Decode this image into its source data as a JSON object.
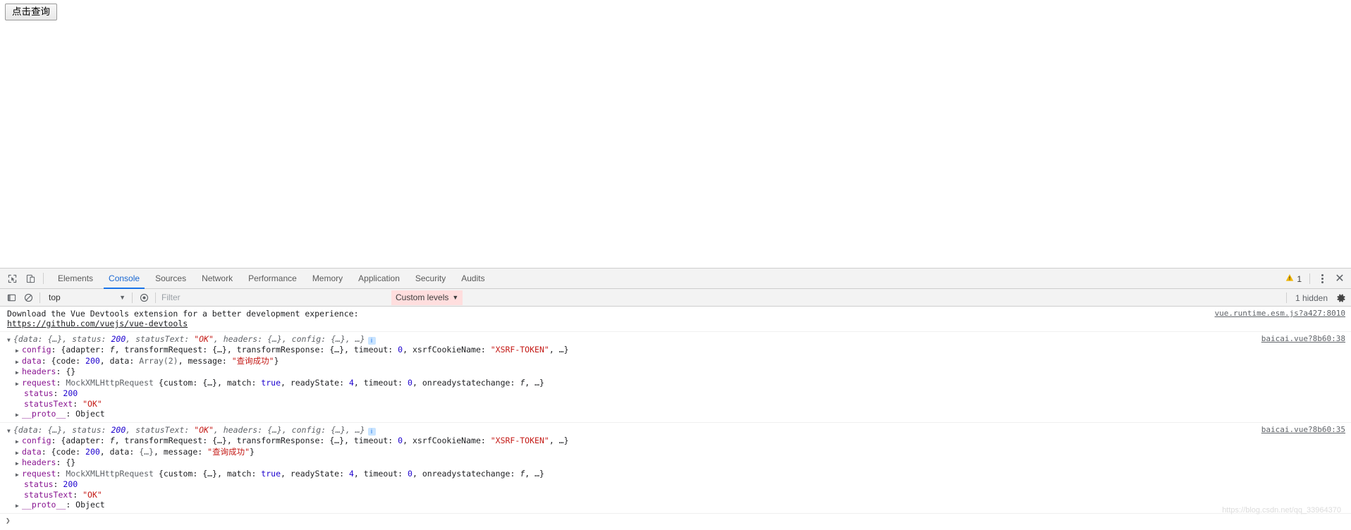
{
  "page": {
    "query_button_label": "点击查询"
  },
  "devtools": {
    "tabbar": {
      "inspect_icon": "inspect-element-icon",
      "device_icon": "device-toolbar-icon",
      "tabs": [
        {
          "label": "Elements",
          "active": false
        },
        {
          "label": "Console",
          "active": true
        },
        {
          "label": "Sources",
          "active": false
        },
        {
          "label": "Network",
          "active": false
        },
        {
          "label": "Performance",
          "active": false
        },
        {
          "label": "Memory",
          "active": false
        },
        {
          "label": "Application",
          "active": false
        },
        {
          "label": "Security",
          "active": false
        },
        {
          "label": "Audits",
          "active": false
        }
      ],
      "warning_count": "1",
      "warning_color": "#f2b600",
      "more_label": "⋮",
      "close_label": "✕"
    },
    "filterbar": {
      "sidebar_icon": "console-sidebar-icon",
      "clear_icon": "clear-console-icon",
      "context": "top",
      "context_caret": "▼",
      "eye_icon": "live-expression-icon",
      "filter_placeholder": "Filter",
      "filter_value": "",
      "levels_label": "Custom levels",
      "levels_caret": "▼",
      "levels_bg": "#ffdede",
      "hidden_label": "1 hidden",
      "gear_icon": "settings-gear-icon"
    },
    "console": {
      "messages": [
        {
          "kind": "vue-devtools-hint",
          "line1": "Download the Vue Devtools extension for a better development experience:",
          "line2": "https://github.com/vuejs/vue-devtools",
          "source": "vue.runtime.esm.js?a427:8010"
        },
        {
          "kind": "response-object",
          "source": "baicai.vue?8b60:38",
          "header": {
            "open_triangle": "▼",
            "text_before_status": "{data: {…}, status: ",
            "status": "200",
            "text_mid": ", statusText: ",
            "status_text": "\"OK\"",
            "text_after": ", headers: {…}, config: {…}, …}",
            "info_badge": "i"
          },
          "config_line": {
            "triangle": "▶",
            "key": "config",
            "before_timeout": ": {adapter: ",
            "fn": "f",
            "mid": ", transformRequest: {…}, transformResponse: {…}, timeout: ",
            "timeout": "0",
            "after_timeout": ", xsrfCookieName: ",
            "xsrf": "\"XSRF-TOKEN\"",
            "tail": ", …}"
          },
          "data_line": {
            "triangle": "▶",
            "key": "data",
            "before_code": ": {code: ",
            "code": "200",
            "mid": ", data: ",
            "data_value": "Array(2)",
            "before_message": ", message: ",
            "message": "\"查询成功\"",
            "tail": "}"
          },
          "headers_line": {
            "triangle": "▶",
            "key": "headers",
            "value": ": {}"
          },
          "request_line": {
            "triangle": "▶",
            "key": "request",
            "class_name": " MockXMLHttpRequest ",
            "before_match": "{custom: {…}, match: ",
            "match": "true",
            "before_ready": ", readyState: ",
            "ready_state": "4",
            "before_timeout": ", timeout: ",
            "timeout": "0",
            "before_onready": ", onreadystatechange: ",
            "fn": "f",
            "tail": ", …}"
          },
          "status_line": {
            "key": "status",
            "sep": ": ",
            "value": "200"
          },
          "status_text_line": {
            "key": "statusText",
            "sep": ": ",
            "value": "\"OK\""
          },
          "proto_line": {
            "triangle": "▶",
            "key": "__proto__",
            "sep": ": ",
            "value": "Object"
          }
        },
        {
          "kind": "response-object",
          "source": "baicai.vue?8b60:35",
          "header": {
            "open_triangle": "▼",
            "text_before_status": "{data: {…}, status: ",
            "status": "200",
            "text_mid": ", statusText: ",
            "status_text": "\"OK\"",
            "text_after": ", headers: {…}, config: {…}, …}",
            "info_badge": "i"
          },
          "config_line": {
            "triangle": "▶",
            "key": "config",
            "before_timeout": ": {adapter: ",
            "fn": "f",
            "mid": ", transformRequest: {…}, transformResponse: {…}, timeout: ",
            "timeout": "0",
            "after_timeout": ", xsrfCookieName: ",
            "xsrf": "\"XSRF-TOKEN\"",
            "tail": ", …}"
          },
          "data_line": {
            "triangle": "▶",
            "key": "data",
            "before_code": ": {code: ",
            "code": "200",
            "mid": ", data: ",
            "data_value": "{…}",
            "before_message": ", message: ",
            "message": "\"查询成功\"",
            "tail": "}"
          },
          "headers_line": {
            "triangle": "▶",
            "key": "headers",
            "value": ": {}"
          },
          "request_line": {
            "triangle": "▶",
            "key": "request",
            "class_name": " MockXMLHttpRequest ",
            "before_match": "{custom: {…}, match: ",
            "match": "true",
            "before_ready": ", readyState: ",
            "ready_state": "4",
            "before_timeout": ", timeout: ",
            "timeout": "0",
            "before_onready": ", onreadystatechange: ",
            "fn": "f",
            "tail": ", …}"
          },
          "status_line": {
            "key": "status",
            "sep": ": ",
            "value": "200"
          },
          "status_text_line": {
            "key": "statusText",
            "sep": ": ",
            "value": "\"OK\""
          },
          "proto_line": {
            "triangle": "▶",
            "key": "__proto__",
            "sep": ": ",
            "value": "Object"
          }
        }
      ],
      "prompt_chevron": "❯",
      "watermark": "https://blog.csdn.net/qq_33964370"
    }
  }
}
